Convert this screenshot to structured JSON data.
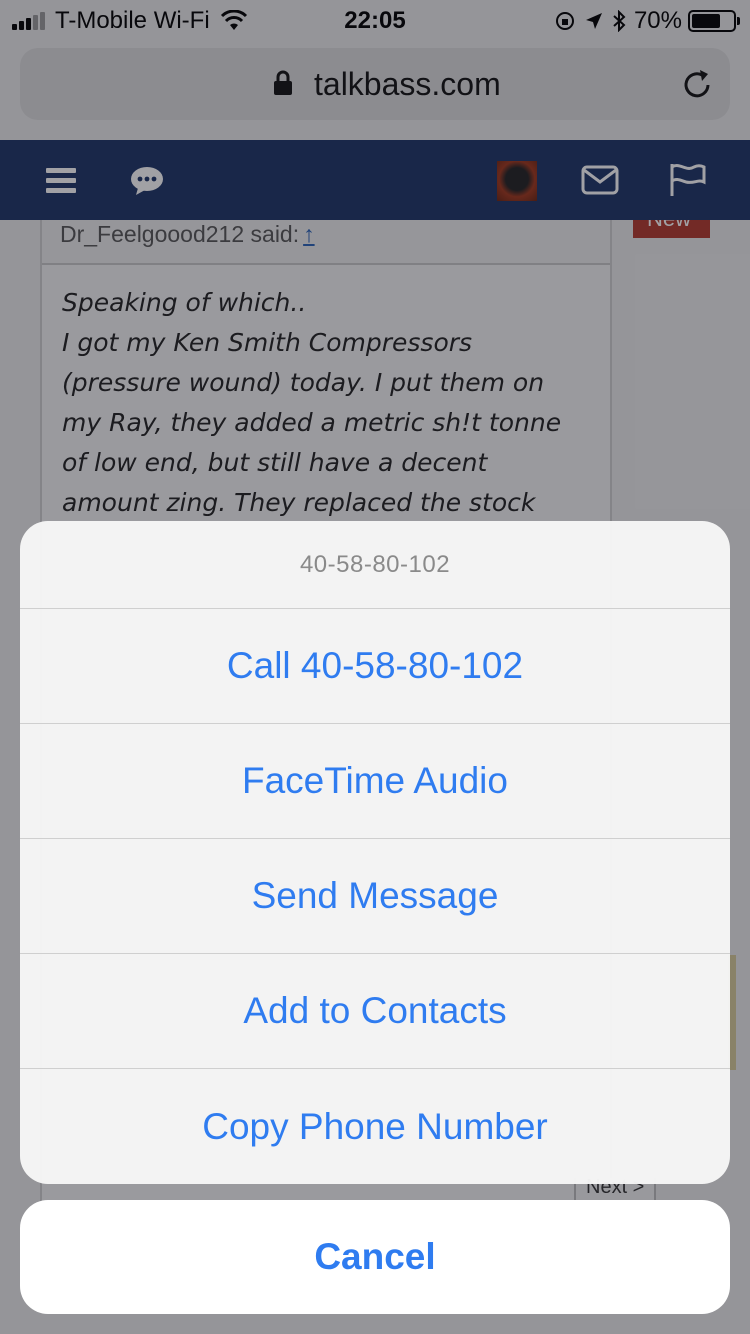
{
  "status_bar": {
    "carrier": "T-Mobile Wi-Fi",
    "time": "22:05",
    "battery_percent": "70%",
    "battery_level": 0.7,
    "icons": [
      "signal-icon",
      "wifi-icon",
      "orientation-lock-icon",
      "location-icon",
      "bluetooth-icon",
      "battery-icon"
    ]
  },
  "browser": {
    "url": "talkbass.com"
  },
  "site_nav": {
    "icons": [
      "menu-icon",
      "chat-icon",
      "avatar",
      "mail-icon",
      "flag-icon"
    ],
    "background": "#1d3466"
  },
  "post": {
    "quote_author": "Dr_Feelgoood212 said:",
    "quote_arrow": "↑",
    "quote_lines": [
      "Speaking of which..",
      "I got my Ken Smith Compressors",
      "(pressure wound) today. I put them on",
      "my Ray, they added a metric sh!t tonne",
      "of low end, but still have a decent",
      "amount zing. They replaced the stock"
    ],
    "new_badge": "New",
    "next_button": "Next >"
  },
  "action_sheet": {
    "title": "40-58-80-102",
    "actions": [
      "Call 40-58-80-102",
      "FaceTime Audio",
      "Send Message",
      "Add to Contacts",
      "Copy Phone Number"
    ],
    "cancel": "Cancel",
    "accent_color": "#2f7cf0"
  }
}
